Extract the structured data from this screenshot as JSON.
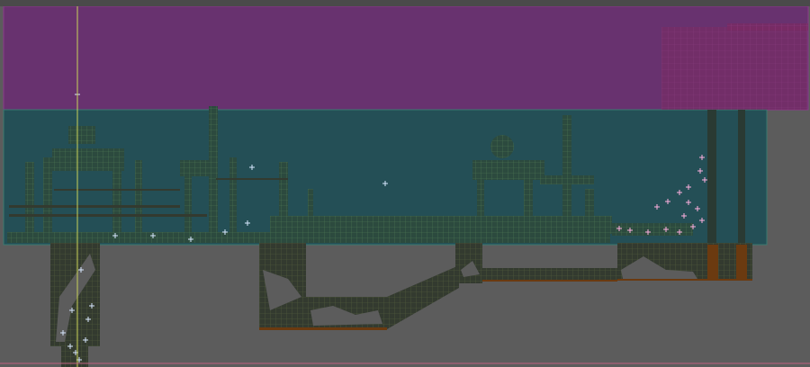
{
  "editor": {
    "background_color": "#5c5c5c",
    "sky_zone_color": "#6a2a72",
    "water_zone_color": "#1e4e55",
    "tile_dark_color": "#333a2f",
    "tile_line_color": "#55603f",
    "tile_edge_color": "#6b3a10",
    "sparkle_color": "#d8e8ff",
    "sparkle_pink_color": "#ffb0e0",
    "cursor_line_color": "#c8d25a",
    "bottom_bound_color": "#c06080",
    "structure_tile_color": "#7a2a62",
    "icons": [
      "sparkle-icon",
      "cursor-crosshair-icon"
    ]
  }
}
